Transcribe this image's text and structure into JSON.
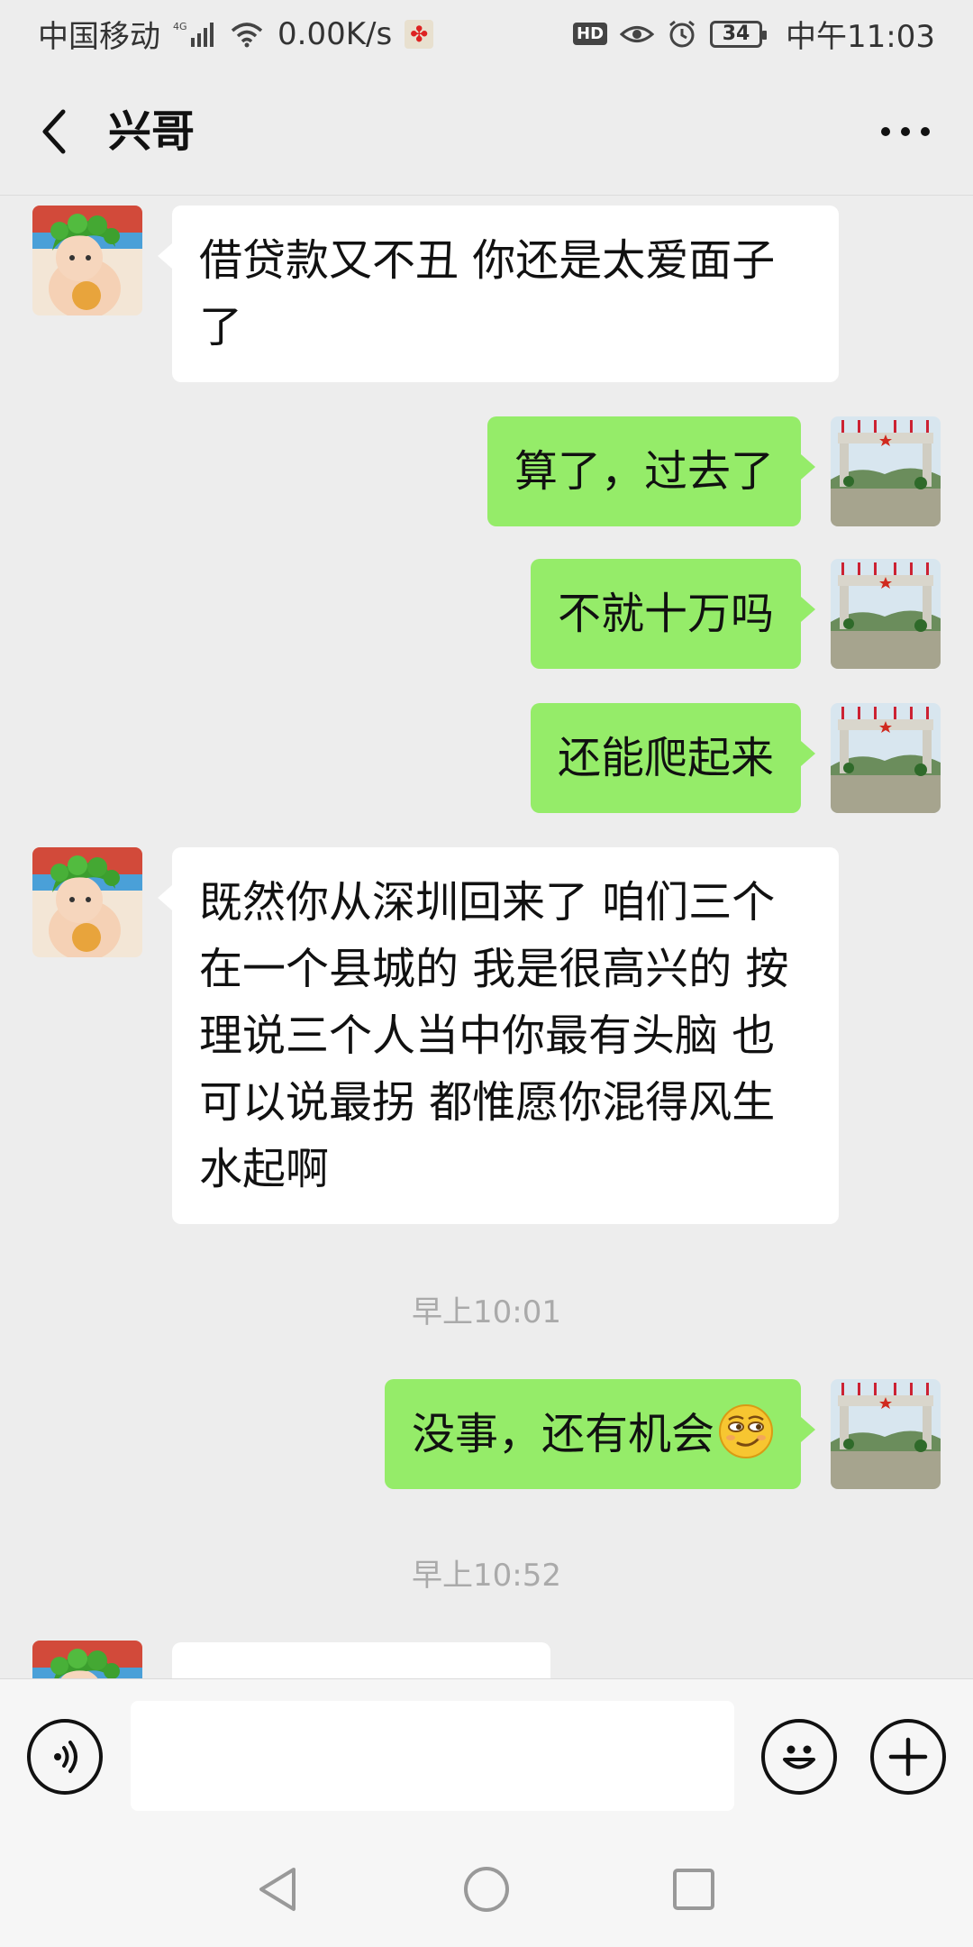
{
  "status_bar": {
    "carrier": "中国移动",
    "network": "4G",
    "speed": "0.00K/s",
    "battery": "34",
    "hd": "HD",
    "time": "中午11:03"
  },
  "header": {
    "title": "兴哥"
  },
  "messages": [
    {
      "side": "in",
      "text": "借贷款又不丑  你还是太爱面子了"
    },
    {
      "side": "out",
      "text": "算了，过去了"
    },
    {
      "side": "out",
      "text": "不就十万吗"
    },
    {
      "side": "out",
      "text": "还能爬起来"
    },
    {
      "side": "in",
      "text": "既然你从深圳回来了  咱们三个在一个县城的  我是很高兴的  按理说三个人当中你最有头脑  也可以说最拐  都惟愿你混得风生水起啊"
    },
    {
      "side": "time",
      "text": "早上10:01"
    },
    {
      "side": "out",
      "text": "没事，还有机会",
      "emoji": "smirk-emoji-icon"
    },
    {
      "side": "time",
      "text": "早上10:52"
    },
    {
      "side": "in",
      "text": ""
    }
  ],
  "input_bar": {
    "placeholder": ""
  },
  "colors": {
    "background": "#ededed",
    "outgoing_bubble": "#95ec69",
    "incoming_bubble": "#ffffff",
    "timestamp": "#aaaaaa"
  },
  "icons": {
    "back": "chevron-left-icon",
    "more": "more-dots-icon",
    "voice": "voice-icon",
    "emoji": "emoji-face-icon",
    "plus": "plus-icon"
  }
}
